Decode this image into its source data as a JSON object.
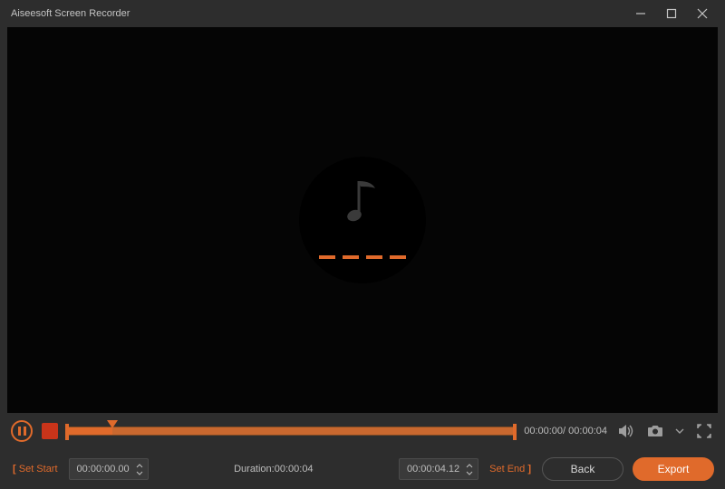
{
  "app": {
    "title": "Aiseesoft Screen Recorder"
  },
  "colors": {
    "accent": "#e06a2b",
    "stop": "#c9341a"
  },
  "playback": {
    "current": "00:00:00",
    "total": "00:00:04"
  },
  "trim": {
    "set_start_label": "Set Start",
    "set_end_label": "Set End",
    "start_time": "00:00:00.00",
    "end_time": "00:00:04.12",
    "duration_label": "Duration:",
    "duration_value": "00:00:04"
  },
  "buttons": {
    "back": "Back",
    "export": "Export"
  },
  "icons": {
    "volume": "volume-icon",
    "camera": "camera-icon",
    "fullscreen": "fullscreen-icon",
    "pause": "pause-icon",
    "stop": "stop-icon",
    "music": "music-note-icon"
  }
}
